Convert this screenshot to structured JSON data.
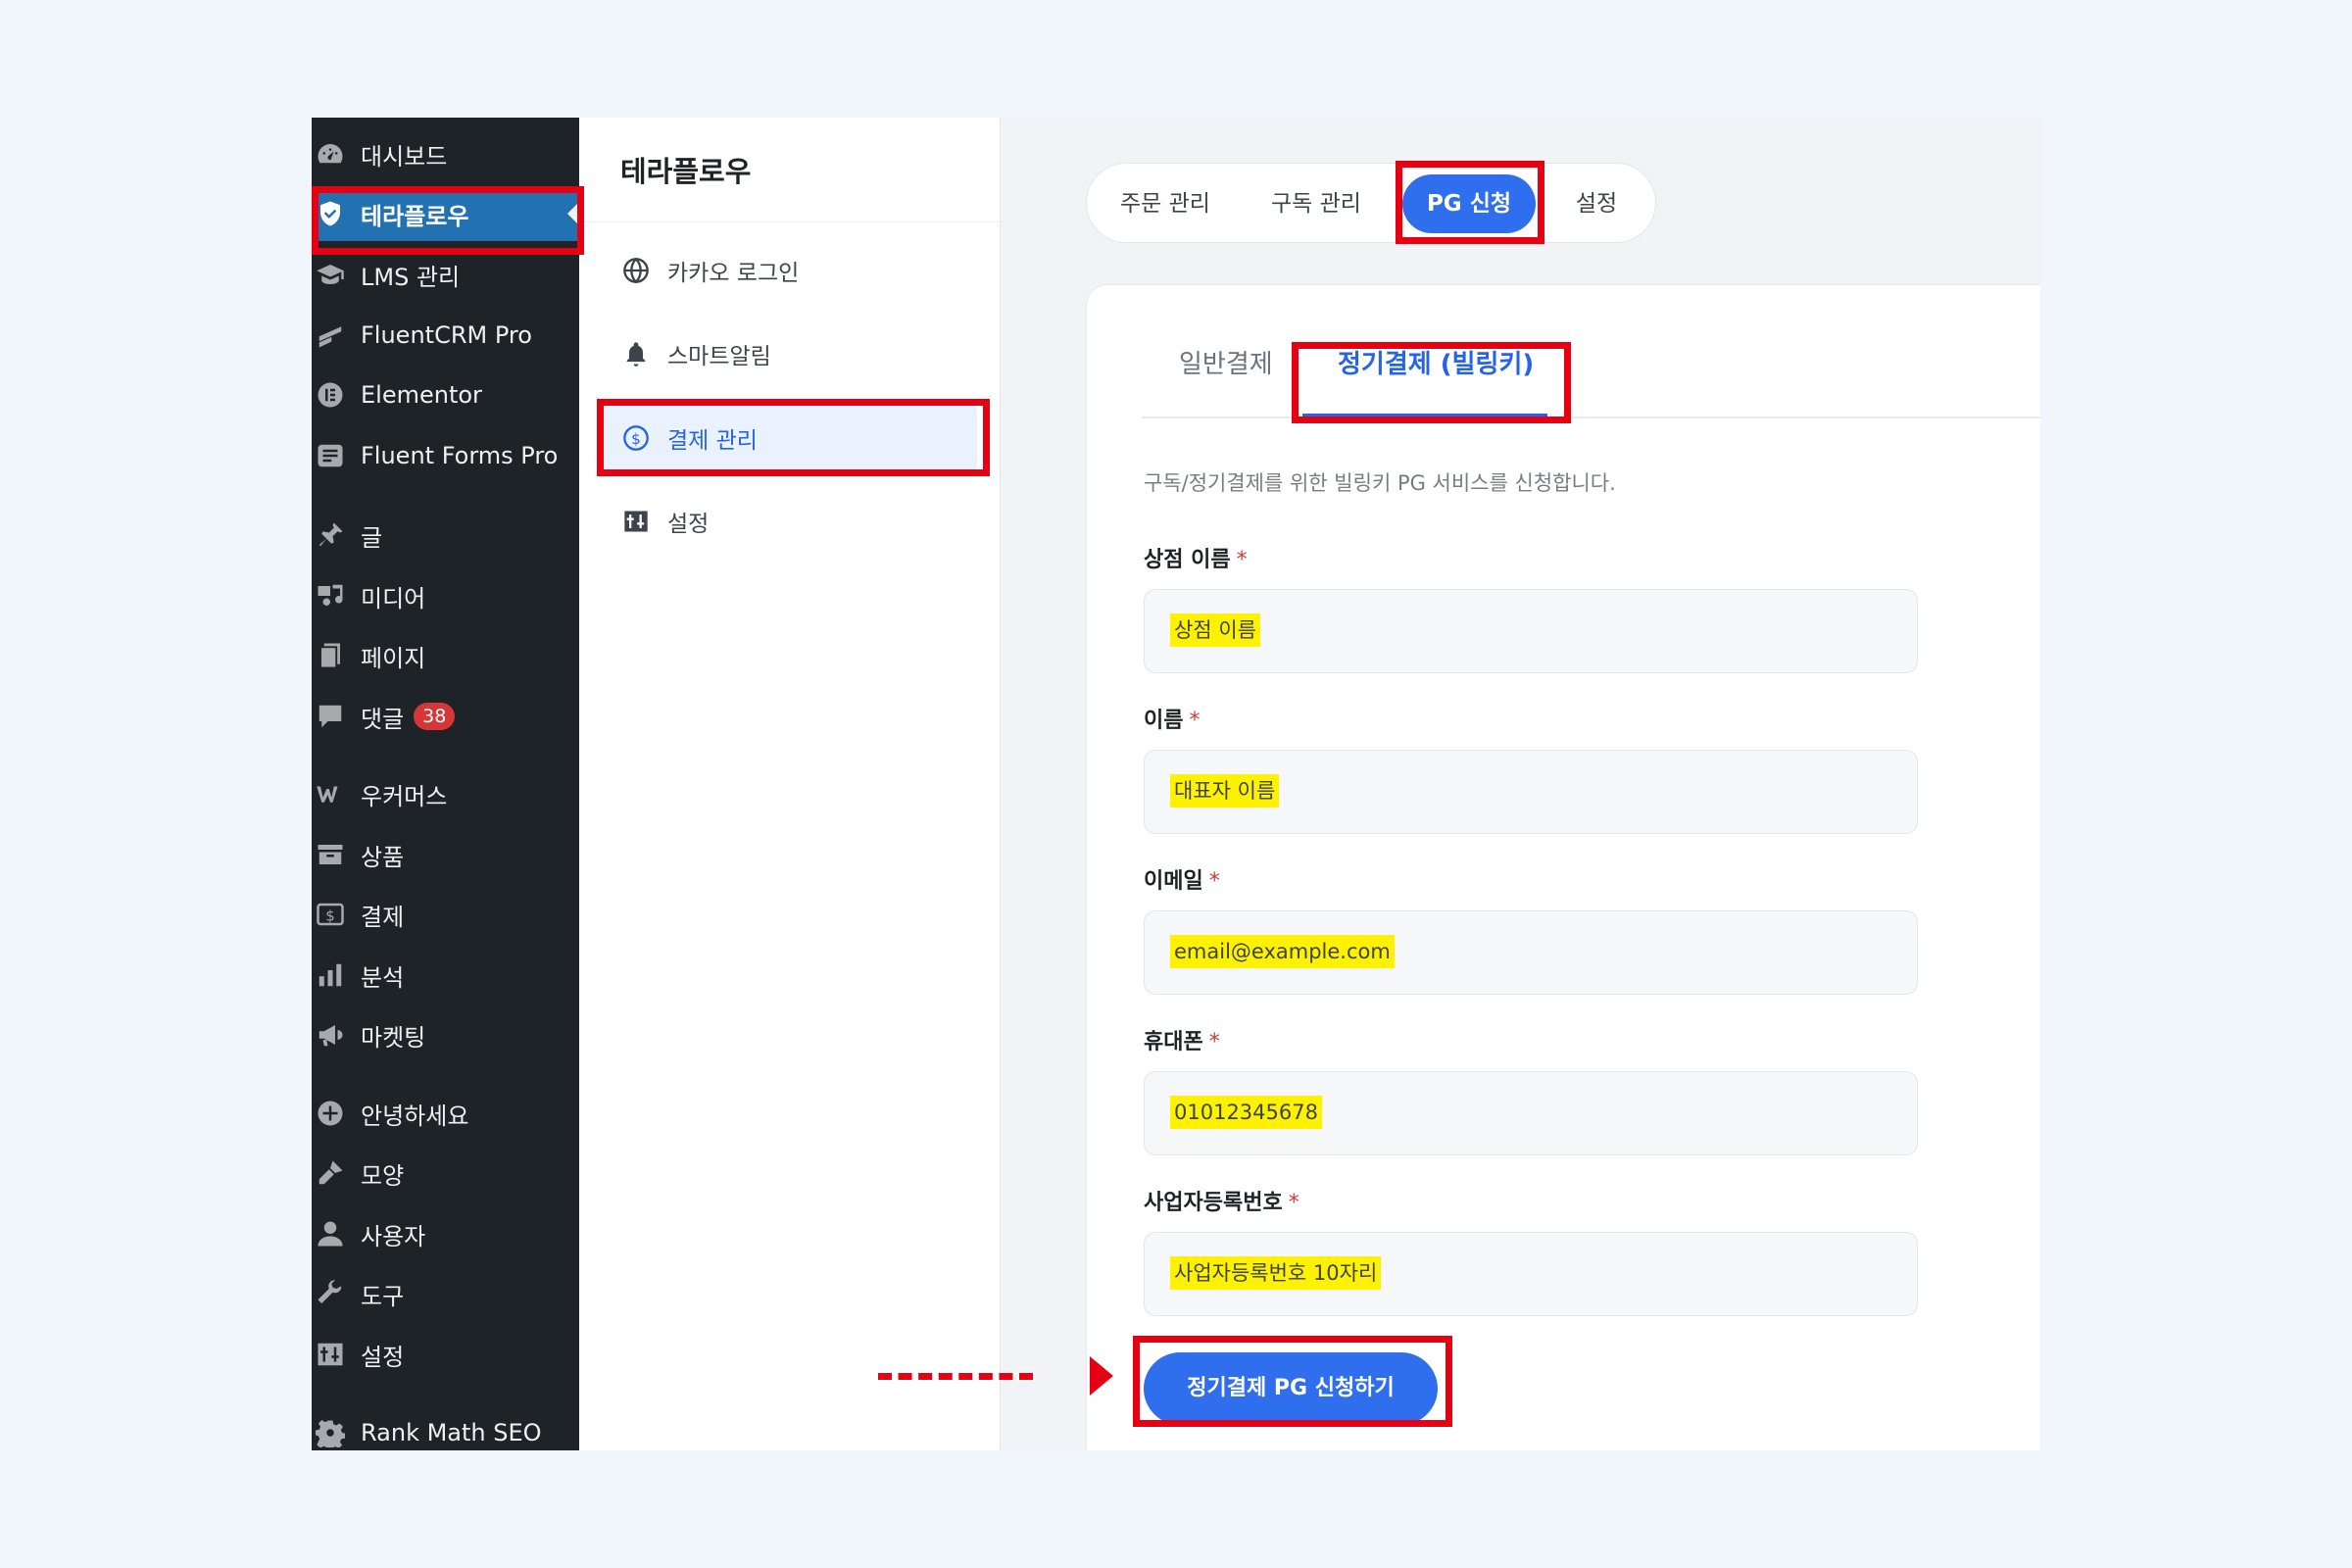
{
  "wp_menu": [
    {
      "label": "대시보드",
      "icon": "dashboard-icon"
    },
    {
      "label": "테라플로우",
      "icon": "shield-icon",
      "active": true
    },
    {
      "label": "LMS 관리",
      "icon": "graduation-cap-icon"
    },
    {
      "label": "FluentCRM Pro",
      "icon": "fluentcrm-icon"
    },
    {
      "label": "Elementor",
      "icon": "elementor-icon"
    },
    {
      "label": "Fluent Forms Pro",
      "icon": "fluentforms-icon"
    },
    {
      "label": "글",
      "icon": "pin-icon"
    },
    {
      "label": "미디어",
      "icon": "media-icon"
    },
    {
      "label": "페이지",
      "icon": "page-icon"
    },
    {
      "label": "댓글",
      "icon": "comment-icon",
      "badge": "38"
    },
    {
      "label": "우커머스",
      "icon": "woocommerce-icon"
    },
    {
      "label": "상품",
      "icon": "archive-icon"
    },
    {
      "label": "결제",
      "icon": "payment-icon"
    },
    {
      "label": "분석",
      "icon": "chart-bar-icon"
    },
    {
      "label": "마켓팅",
      "icon": "megaphone-icon"
    },
    {
      "label": "안녕하세요",
      "icon": "plus-circle-icon"
    },
    {
      "label": "모양",
      "icon": "brush-icon"
    },
    {
      "label": "사용자",
      "icon": "user-icon"
    },
    {
      "label": "도구",
      "icon": "wrench-icon"
    },
    {
      "label": "설정",
      "icon": "settings-icon"
    },
    {
      "label": "Rank Math SEO",
      "icon": "gear-icon"
    }
  ],
  "plugin": {
    "title": "테라플로우",
    "menu": [
      {
        "label": "카카오 로그인",
        "icon": "globe-icon"
      },
      {
        "label": "스마트알림",
        "icon": "bell-icon"
      },
      {
        "label": "결제 관리",
        "icon": "dollar-circle-icon",
        "active": true
      },
      {
        "label": "설정",
        "icon": "settings-icon"
      }
    ]
  },
  "tabs": [
    {
      "label": "주문 관리"
    },
    {
      "label": "구독 관리"
    },
    {
      "label": "PG 신청",
      "active": true
    },
    {
      "label": "설정"
    }
  ],
  "form": {
    "subtabs": [
      {
        "label": "일반결제"
      },
      {
        "label": "정기결제 (빌링키)",
        "active": true
      }
    ],
    "description": "구독/정기결제를 위한 빌링키 PG 서비스를 신청합니다.",
    "fields": [
      {
        "label": "상점 이름",
        "required": "*",
        "value": "상점 이름"
      },
      {
        "label": "이름",
        "required": "*",
        "value": "대표자 이름"
      },
      {
        "label": "이메일",
        "required": "*",
        "value": "email@example.com"
      },
      {
        "label": "휴대폰",
        "required": "*",
        "value": "01012345678"
      },
      {
        "label": "사업자등록번호",
        "required": "*",
        "value": "사업자등록번호 10자리"
      }
    ],
    "submit_label": "정기결제 PG 신청하기"
  },
  "colors": {
    "primary": "#2f6fed",
    "highlight": "#e60012",
    "sidebar": "#1d2327",
    "marker": "#fff200"
  }
}
